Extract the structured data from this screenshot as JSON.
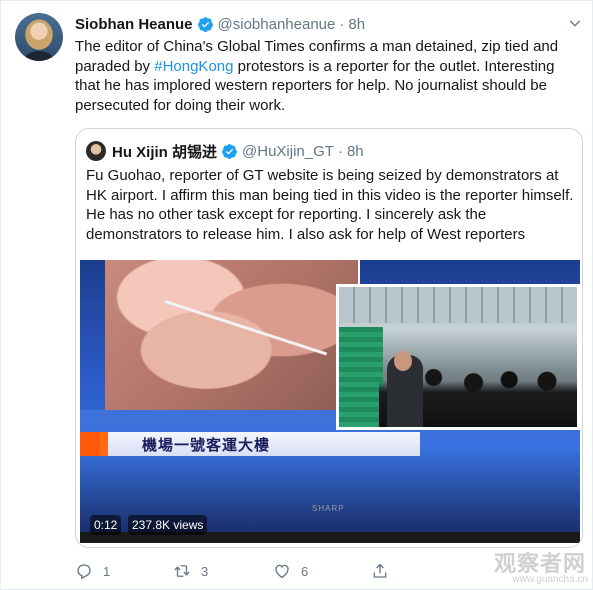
{
  "tweet": {
    "author_name": "Siobhan Heanue",
    "author_handle": "@siobhanheanue",
    "dot": "·",
    "time": "8h",
    "text_before": "The editor of China's Global Times confirms a man detained, zip tied and paraded by ",
    "hashtag": "#HongKong",
    "text_after": " protestors is a reporter for the outlet. Interesting that he has implored western reporters for help. No journalist should be persecuted for doing their work."
  },
  "quoted_tweet": {
    "author_name": "Hu Xijin 胡锡进",
    "author_handle": "@HuXijin_GT",
    "dot": "·",
    "time": "8h",
    "text": "Fu Guohao, reporter of GT website is being seized by demonstrators at HK airport. I affirm this man being tied in this video is the reporter himself. He has no other task except for reporting. I sincerely ask the demonstrators to release him. I also ask for help of West reporters"
  },
  "video": {
    "duration": "0:12",
    "views": "237.8K views",
    "caption": "機場一號客運大樓",
    "tv_brand": "SHARP"
  },
  "actions": {
    "reply_count": "1",
    "retweet_count": "3",
    "like_count": "6"
  },
  "watermark": {
    "main": "观察者网",
    "sub": "www.guancha.cn"
  },
  "colors": {
    "link": "#1b95e0",
    "verified": "#1da1f2",
    "secondary_text": "#657786",
    "border": "#ccd6dd"
  },
  "icons": {
    "reply": "reply-icon",
    "retweet": "retweet-icon",
    "like": "heart-icon",
    "share": "share-icon",
    "menu": "chevron-down-icon",
    "verified": "verified-badge-icon"
  }
}
